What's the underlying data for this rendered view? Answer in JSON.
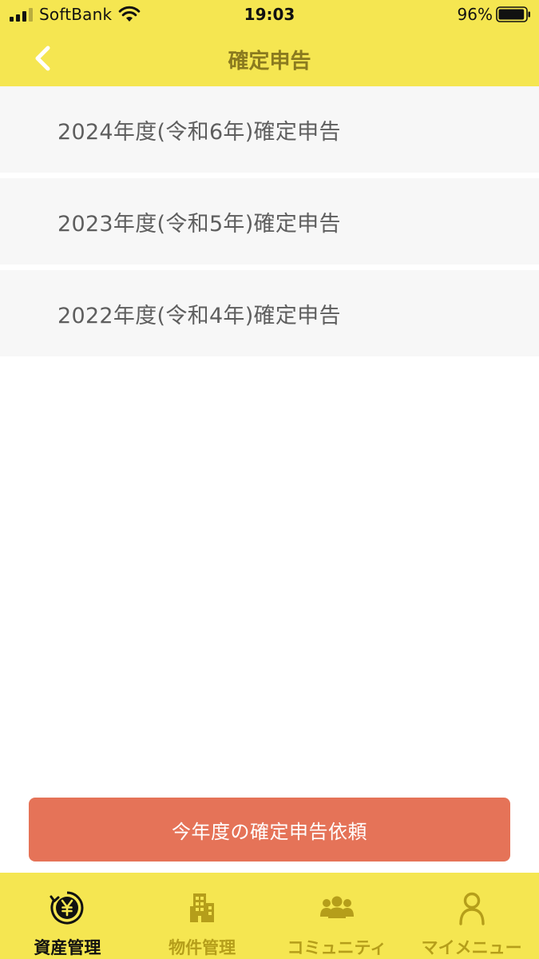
{
  "status_bar": {
    "carrier": "SoftBank",
    "time": "19:03",
    "battery_percent": "96%",
    "battery_level": 0.96,
    "signal_icon": "cellular-signal-icon",
    "wifi_icon": "wifi-icon",
    "battery_icon": "battery-icon"
  },
  "nav": {
    "title": "確定申告",
    "back_icon": "chevron-left-icon"
  },
  "list": {
    "items": [
      {
        "label": "2024年度(令和6年)確定申告"
      },
      {
        "label": "2023年度(令和5年)確定申告"
      },
      {
        "label": "2022年度(令和4年)確定申告"
      }
    ]
  },
  "request_button": {
    "label": "今年度の確定申告依頼"
  },
  "tab_bar": {
    "tabs": [
      {
        "label": "資産管理",
        "icon": "yen-coin-icon",
        "active": true
      },
      {
        "label": "物件管理",
        "icon": "building-icon",
        "active": false
      },
      {
        "label": "コミュニティ",
        "icon": "people-group-icon",
        "active": false
      },
      {
        "label": "マイメニュー",
        "icon": "person-icon",
        "active": false
      }
    ]
  },
  "colors": {
    "header_yellow": "#f5e651",
    "title_text": "#8a7a1f",
    "request_button": "#e57358",
    "tab_inactive": "#b59e1a",
    "tab_active": "#111111",
    "list_background": "#f7f7f7"
  }
}
